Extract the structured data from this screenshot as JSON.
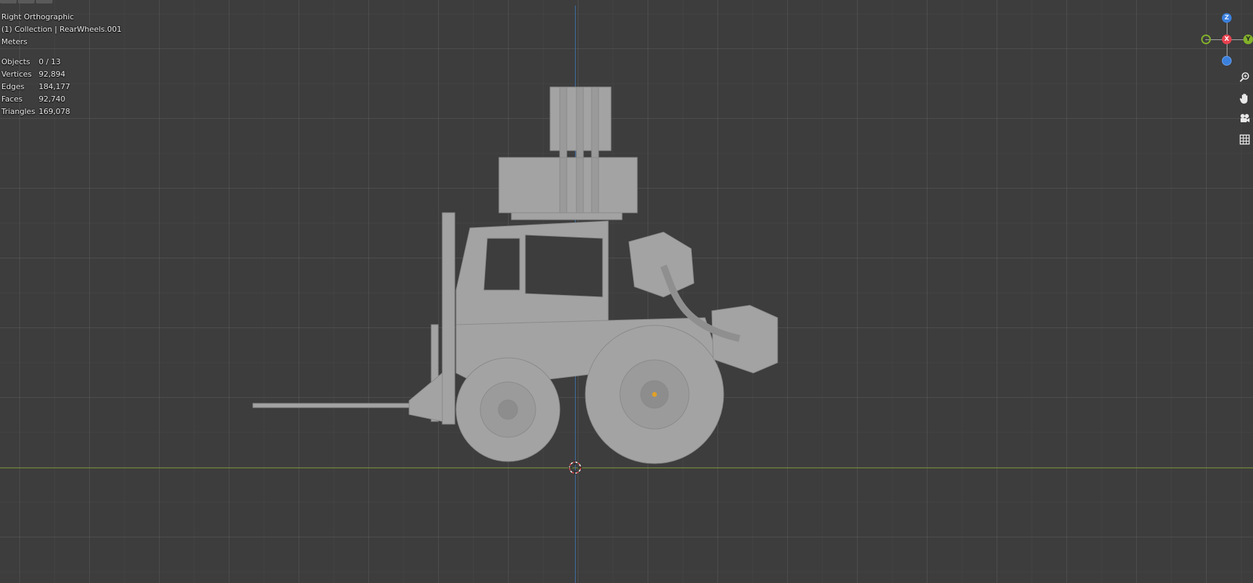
{
  "viewport": {
    "view_name": "Right Orthographic",
    "collection": "(1) Collection | RearWheels.001",
    "units": "Meters"
  },
  "stats": {
    "objects": {
      "label": "Objects",
      "value": "0 / 13"
    },
    "vertices": {
      "label": "Vertices",
      "value": "92,894"
    },
    "edges": {
      "label": "Edges",
      "value": "184,177"
    },
    "faces": {
      "label": "Faces",
      "value": "92,740"
    },
    "triangles": {
      "label": "Triangles",
      "value": "169,078"
    }
  },
  "gizmo": {
    "axis_z_label": "Z",
    "axis_x_label": "X",
    "axis_y_label": "Y",
    "colors": {
      "x": "#e8414f",
      "y": "#82b12a",
      "z": "#3b80dc"
    }
  },
  "navigation": {
    "zoom_icon": "zoom-icon",
    "pan_icon": "hand-icon",
    "camera_icon": "camera-icon",
    "ortho_icon": "grid-icon"
  },
  "colors": {
    "background": "#3d3d3d",
    "axis_y": "#6f8f2a",
    "axis_z": "#3e6fa6",
    "model": "#a3a3a3"
  }
}
